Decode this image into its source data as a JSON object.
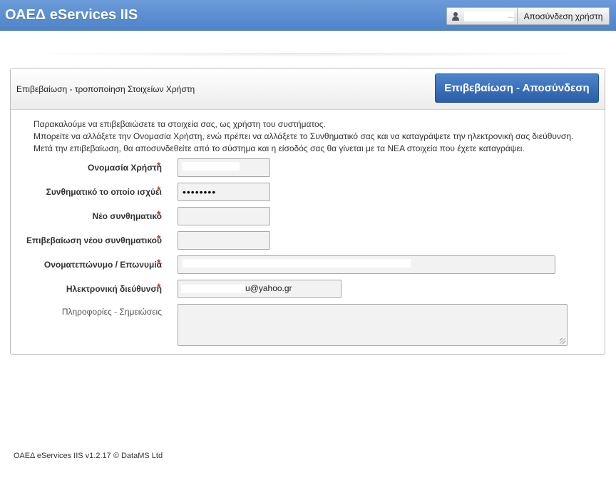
{
  "header": {
    "app_title": "ΟΑΕΔ eServices IIS",
    "user_name_masked": "...",
    "logout_user_label": "Αποσύνδεση χρήστη"
  },
  "panel": {
    "title": "Επιβεβαίωση - τροποποίηση Στοιχείων Χρήστη",
    "confirm_button_label": "Επιβεβαίωση - Αποσύνδεση",
    "intro_lines": [
      "Παρακαλούμε να επιβεβαιώσετε τα στοιχεία σας, ως χρήστη του συστήματος.",
      "Μπορείτε να αλλάξετε την Ονομασία Χρήστη, ενώ πρέπει να αλλάξετε το Συνθηματικό σας και να καταγράψετε την ηλεκτρονική σας διεύθυνση.",
      "Μετά την επιβεβαίωση, θα αποσυνδεθείτε από το σύστημα και η είσοδός σας θα γίνεται με τα ΝΕΑ στοιχεία που έχετε καταγράψει."
    ]
  },
  "form": {
    "username_label": "Ονομασία Χρήστη",
    "username_value": "",
    "current_password_label": "Συνθηματικό το οποίο ισχύει",
    "current_password_value": "••••••••",
    "new_password_label": "Νέο συνθηματικό",
    "new_password_value": "",
    "confirm_password_label": "Επιβεβαίωση νέου συνθηματικού",
    "confirm_password_value": "",
    "fullname_label": "Ονοματεπώνυμο / Επωνυμία",
    "fullname_value": "",
    "email_label": "Ηλεκτρονική διεύθυνση",
    "email_value": "u@yahoo.gr",
    "notes_label": "Πληροφορίες - Σημειώσεις",
    "notes_value": "",
    "required_marker": "*"
  },
  "footer": {
    "text": "ΟΑΕΔ eServices IIS v1.2.17 © DataMS Ltd"
  },
  "colors": {
    "topbar": "#5b8fd1",
    "button": "#2f64ab",
    "required": "#c0392b"
  },
  "icons": {
    "user": "user-icon"
  }
}
